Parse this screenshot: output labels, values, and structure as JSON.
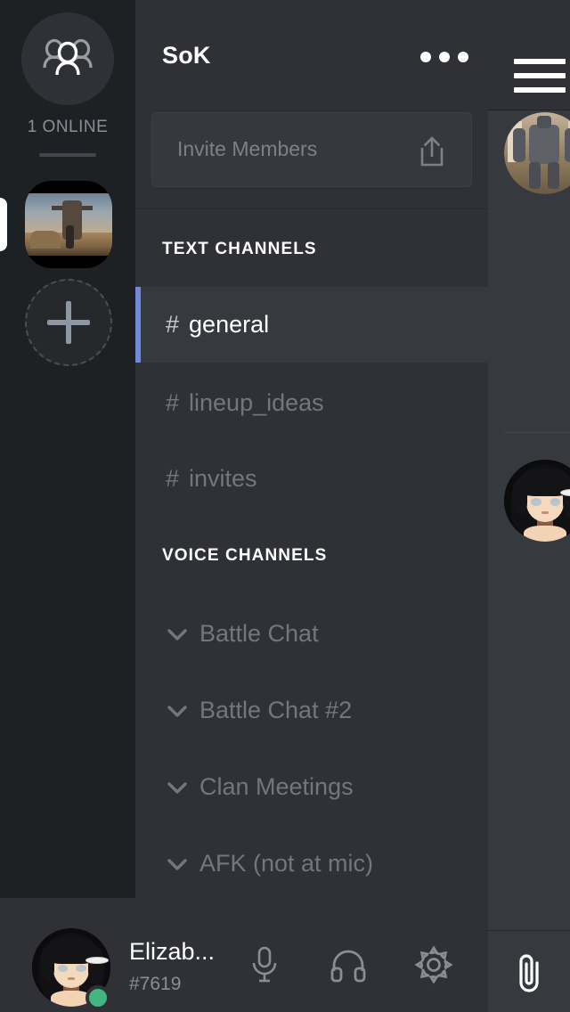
{
  "server_rail": {
    "home_icon": "people-group-icon",
    "online_status": "1 ONLINE",
    "servers": [
      {
        "name": "SoK",
        "icon": "server-thumbnail-game",
        "active": true
      }
    ],
    "add_server_label": "+",
    "add_server_icon": "plus-icon"
  },
  "channel_panel": {
    "guild_name": "SoK",
    "more_icon": "ellipsis-icon",
    "invite": {
      "label": "Invite Members",
      "icon": "share-icon"
    },
    "categories": [
      {
        "title": "TEXT CHANNELS",
        "type": "text",
        "channels": [
          {
            "name": "general",
            "prefix": "#",
            "active": true
          },
          {
            "name": "lineup_ideas",
            "prefix": "#",
            "active": false
          },
          {
            "name": "invites",
            "prefix": "#",
            "active": false
          }
        ]
      },
      {
        "title": "VOICE CHANNELS",
        "type": "voice",
        "channels": [
          {
            "name": "Battle Chat",
            "icon": "chevron-down-icon",
            "active": false
          },
          {
            "name": "Battle Chat #2",
            "icon": "chevron-down-icon",
            "active": false
          },
          {
            "name": "Clan Meetings",
            "icon": "chevron-down-icon",
            "active": false
          },
          {
            "name": "AFK (not at mic)",
            "icon": "chevron-down-icon",
            "active": false
          }
        ]
      }
    ]
  },
  "chat_peek": {
    "menu_icon": "hamburger-menu-icon",
    "attachment_icon": "paperclip-icon",
    "avatars": [
      {
        "name": "message-avatar-mech"
      },
      {
        "name": "message-avatar-anime"
      }
    ]
  },
  "user_bar": {
    "username": "Elizab...",
    "discriminator": "#7619",
    "status": "online",
    "avatar_icon": "user-avatar",
    "buttons": [
      {
        "name": "microphone-icon",
        "label": "Mute"
      },
      {
        "name": "headphones-icon",
        "label": "Deafen"
      },
      {
        "name": "gear-icon",
        "label": "User Settings"
      }
    ]
  },
  "colors": {
    "rail_bg": "#1E2124",
    "panel_bg": "#2F3136",
    "chat_bg": "#36393E",
    "accent_blurple": "#7289DA",
    "online_green": "#43B581",
    "text_muted": "#72767D",
    "text_primary": "#FFFFFF"
  }
}
